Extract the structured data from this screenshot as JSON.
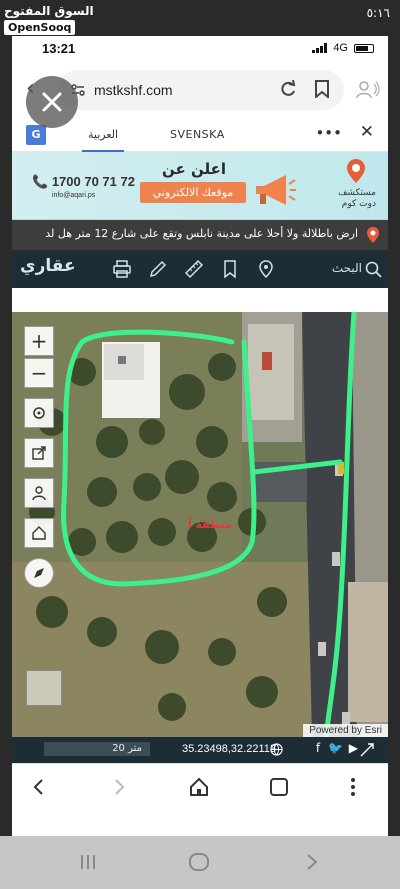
{
  "app": {
    "watermark_ar": "السوق المفتوح",
    "watermark_en": "OpenSooq",
    "outer_time": "٥:١٦"
  },
  "ios_status": {
    "time": "13:21",
    "network": "4G"
  },
  "browser": {
    "url": "mstkshf.com"
  },
  "translate_bar": {
    "source_lang": "العربية",
    "target_lang": "SVENSKA"
  },
  "ad": {
    "title": "اعلن عن",
    "subtitle": "موقعك الالكتروني",
    "phone": "1700 70 71 72",
    "email": "info@aqari.ps",
    "brand": "مستكشف",
    "brand_sub": "دوت كوم"
  },
  "ticker": {
    "text": "ارض باطلالة ولا أحلا على مدينة نابلس وتقع على شارع 12 متر هل لد"
  },
  "map_toolbar": {
    "logo": "عقاري",
    "search_label": "البحث"
  },
  "map": {
    "parcel_label": "منطقة أ",
    "attribution": "Powered by Esri",
    "parcel_color": "#3df08a"
  },
  "map_footer": {
    "scale": "20 متر",
    "coordinates": "35.23498,32.22113"
  },
  "colors": {
    "toolbar_bg": "#1c2d36",
    "ad_accent": "#f0824d",
    "highlight": "#3df08a"
  }
}
